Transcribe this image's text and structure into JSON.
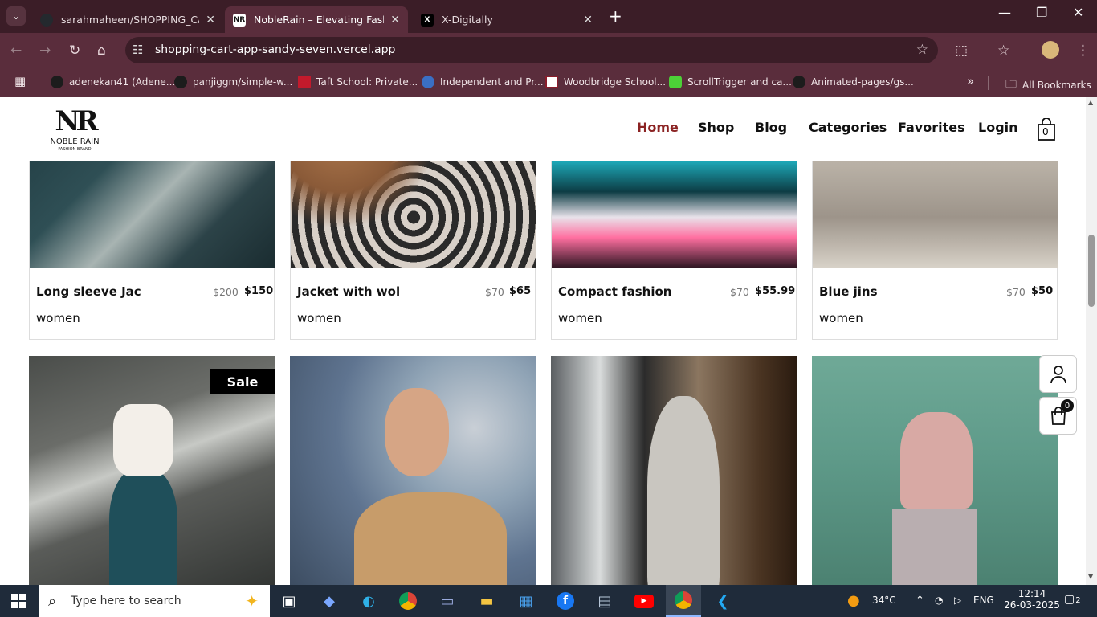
{
  "browser": {
    "tabs": [
      {
        "title": "sarahmaheen/SHOPPING_CART",
        "active": false
      },
      {
        "title": "NobleRain – Elevating Fashion w",
        "active": true
      },
      {
        "title": "X-Digitally",
        "active": false
      }
    ],
    "new_tab": "+",
    "url": "shopping-cart-app-sandy-seven.vercel.app",
    "bookmarks": [
      "adenekan41 (Adene...",
      "panjiggm/simple-w...",
      "Taft School: Private...",
      "Independent and Pr...",
      "Woodbridge School...",
      "ScrollTrigger and ca...",
      "Animated-pages/gs..."
    ],
    "all_bookmarks": "All Bookmarks"
  },
  "site": {
    "logo": {
      "mark": "NR",
      "name": "NOBLE RAIN",
      "sub": "FASHION BRAND"
    },
    "nav": [
      "Home",
      "Shop",
      "Blog",
      "Categories",
      "Favorites",
      "Login"
    ],
    "cart_count": "0",
    "float_cart_count": "0",
    "products_row1": [
      {
        "name": "Long sleeve Jac",
        "old_price": "$200",
        "price": "$150",
        "category": "women"
      },
      {
        "name": "Jacket with wol",
        "old_price": "$70",
        "price": "$65",
        "category": "women"
      },
      {
        "name": "Compact fashion",
        "old_price": "$70",
        "price": "$55.99",
        "category": "women"
      },
      {
        "name": "Blue jins",
        "old_price": "$70",
        "price": "$50",
        "category": "women"
      }
    ],
    "sale_badge": "Sale"
  },
  "taskbar": {
    "search_placeholder": "Type here to search",
    "weather": "34°C",
    "lang": "ENG",
    "time": "12:14",
    "date": "26-03-2025",
    "notifications": "2"
  }
}
